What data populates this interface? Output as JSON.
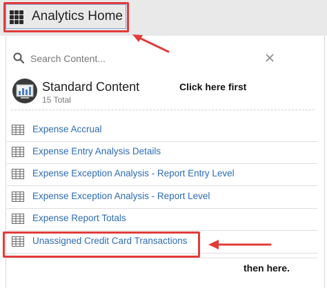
{
  "header": {
    "home_label": "Analytics Home"
  },
  "search": {
    "placeholder": "Search Content..."
  },
  "section": {
    "title": "Standard Content",
    "subtitle": "15 Total"
  },
  "report_list": [
    "Expense Accrual",
    "Expense Entry Analysis Details",
    "Expense Exception Analysis - Report Entry Level",
    "Expense Exception Analysis - Report Level",
    "Expense Report Totals",
    "Unassigned Credit Card Transactions"
  ],
  "annotations": {
    "first": "Click here first",
    "second": "then here."
  },
  "colors": {
    "link": "#2d6cb4",
    "highlight": "#e23b3b",
    "header_bg": "#e9e9e9"
  },
  "icons": {
    "apps": "apps-grid-icon",
    "search": "search-icon",
    "close": "close-icon",
    "section": "standard-content-icon",
    "item": "table-icon"
  }
}
